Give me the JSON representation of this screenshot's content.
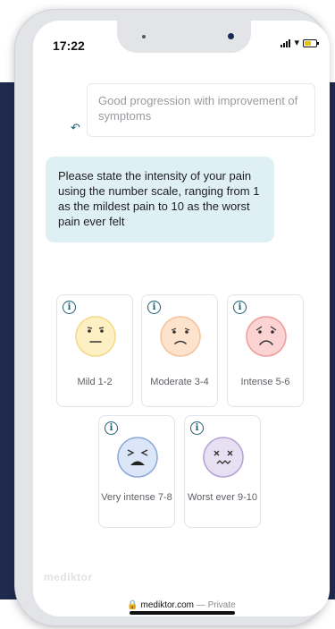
{
  "status_bar": {
    "time": "17:22"
  },
  "chat": {
    "previous_answer": "Good progression with improvement of symptoms",
    "question": "Please state the intensity of your pain using the number scale, ranging from 1 as the mildest pain to 10 as the worst pain ever felt"
  },
  "pain_options": [
    {
      "label": "Mild 1-2",
      "face_color": "#fdf1c4",
      "face_stroke": "#f2d98a"
    },
    {
      "label": "Moderate 3-4",
      "face_color": "#fde2cc",
      "face_stroke": "#f3c39c"
    },
    {
      "label": "Intense 5-6",
      "face_color": "#fbd3d2",
      "face_stroke": "#ef9c9a"
    },
    {
      "label": "Very intense 7-8",
      "face_color": "#dbe6f8",
      "face_stroke": "#8da8d8"
    },
    {
      "label": "Worst ever 9-10",
      "face_color": "#e7dff2",
      "face_stroke": "#b4a2d2"
    }
  ],
  "info_icon_glyph": "i",
  "brand": "mediktor",
  "browser": {
    "domain": "mediktor.com",
    "separator": "—",
    "mode": "Private"
  },
  "colors": {
    "accent": "#1e5f74",
    "bubble": "#dff0f4",
    "background_band": "#1f2a4f"
  }
}
